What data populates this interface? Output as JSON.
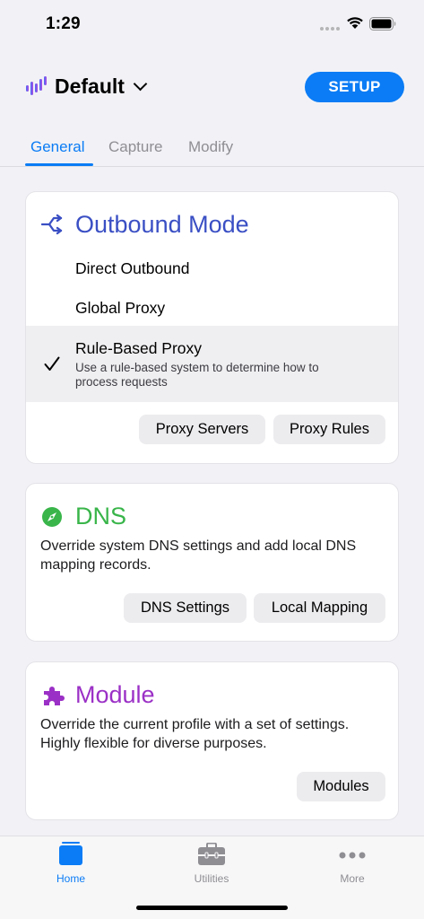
{
  "status_bar": {
    "time": "1:29"
  },
  "header": {
    "profile_name": "Default",
    "setup_label": "SETUP"
  },
  "tabs": [
    {
      "label": "General",
      "active": true
    },
    {
      "label": "Capture",
      "active": false
    },
    {
      "label": "Modify",
      "active": false
    }
  ],
  "outbound": {
    "title": "Outbound Mode",
    "modes": [
      {
        "label": "Direct Outbound"
      },
      {
        "label": "Global Proxy"
      },
      {
        "label": "Rule-Based Proxy",
        "description": "Use a rule-based system to determine how to process requests",
        "selected": true
      }
    ],
    "buttons": {
      "proxy_servers": "Proxy Servers",
      "proxy_rules": "Proxy Rules"
    }
  },
  "dns": {
    "title": "DNS",
    "description": "Override system DNS settings and add local DNS mapping records.",
    "buttons": {
      "settings": "DNS Settings",
      "local_mapping": "Local Mapping"
    }
  },
  "module": {
    "title": "Module",
    "description": "Override the current profile with a set of settings. Highly flexible for diverse purposes.",
    "buttons": {
      "modules": "Modules"
    }
  },
  "tabbar": [
    {
      "label": "Home",
      "icon": "home-icon",
      "active": true
    },
    {
      "label": "Utilities",
      "icon": "toolbox-icon",
      "active": false
    },
    {
      "label": "More",
      "icon": "more-icon",
      "active": false
    }
  ],
  "colors": {
    "accent": "#0b7cf5",
    "outbound": "#3a4fc4",
    "dns": "#39b54a",
    "module": "#9b30c6",
    "background": "#f2f2f6"
  }
}
